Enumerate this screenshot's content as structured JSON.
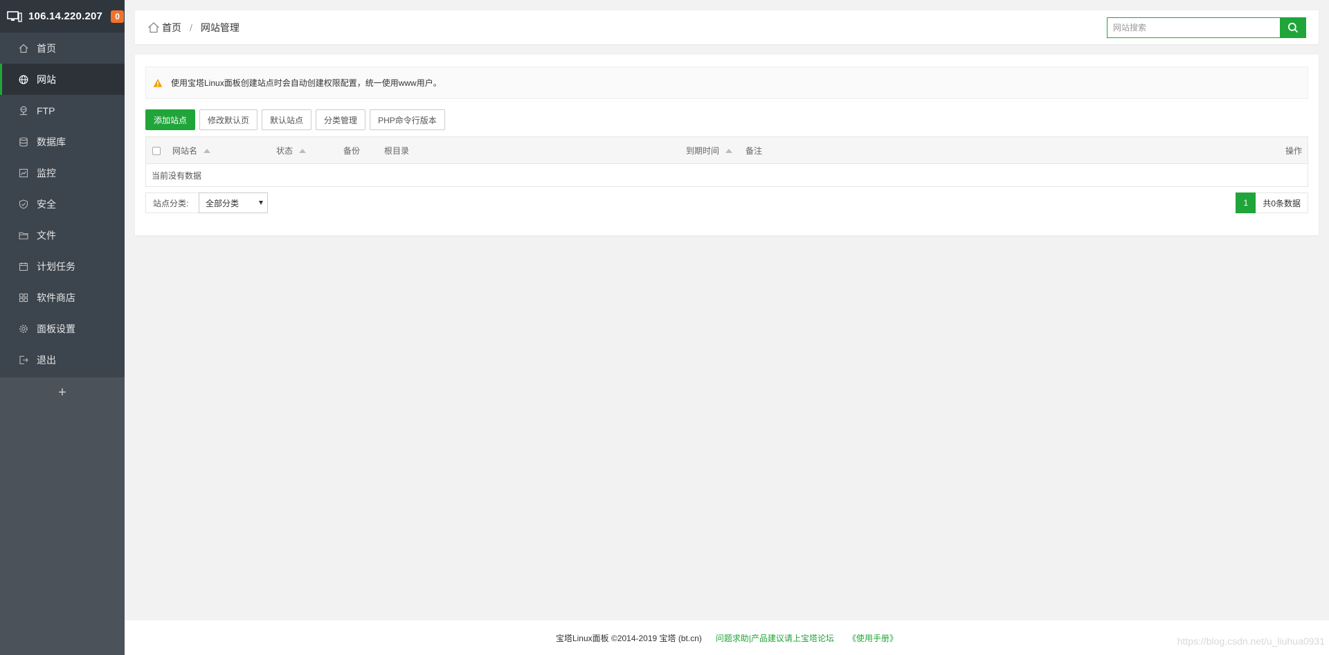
{
  "sidebar": {
    "ip": "106.14.220.207",
    "badge": "0",
    "items": [
      {
        "label": "首页",
        "icon": "home-icon"
      },
      {
        "label": "网站",
        "icon": "globe-icon"
      },
      {
        "label": "FTP",
        "icon": "ftp-icon"
      },
      {
        "label": "数据库",
        "icon": "database-icon"
      },
      {
        "label": "监控",
        "icon": "monitor-chart-icon"
      },
      {
        "label": "安全",
        "icon": "shield-icon"
      },
      {
        "label": "文件",
        "icon": "folder-icon"
      },
      {
        "label": "计划任务",
        "icon": "calendar-icon"
      },
      {
        "label": "软件商店",
        "icon": "grid-icon"
      },
      {
        "label": "面板设置",
        "icon": "gear-icon"
      },
      {
        "label": "退出",
        "icon": "logout-icon"
      }
    ],
    "active_index": 1,
    "add_symbol": "+"
  },
  "topbar": {
    "breadcrumb_home": "首页",
    "breadcrumb_sep": "/",
    "breadcrumb_current": "网站管理",
    "search_placeholder": "网站搜索"
  },
  "notice": {
    "text": "使用宝塔Linux面板创建站点时会自动创建权限配置，统一使用www用户。"
  },
  "toolbar": {
    "add_site": "添加站点",
    "modify_default_page": "修改默认页",
    "default_site": "默认站点",
    "category_manage": "分类管理",
    "php_cli_version": "PHP命令行版本"
  },
  "table": {
    "columns": {
      "name": "网站名",
      "status": "状态",
      "backup": "备份",
      "root": "根目录",
      "expire": "到期时间",
      "remark": "备注",
      "actions": "操作"
    },
    "empty_text": "当前没有数据"
  },
  "filter": {
    "label": "站点分类:",
    "selected": "全部分类"
  },
  "pager": {
    "current_page": "1",
    "total_text": "共0条数据"
  },
  "footer": {
    "copyright": "宝塔Linux面板 ©2014-2019 宝塔 (bt.cn)",
    "forum_link": "问题求助|产品建议请上宝塔论坛",
    "manual_link": "《使用手册》"
  },
  "watermark": "https://blog.csdn.net/u_liuhua0931",
  "colors": {
    "accent": "#20a53a",
    "sidebar_bg": "#3c444d",
    "badge": "#f0732d",
    "warning": "#f0a30a"
  }
}
